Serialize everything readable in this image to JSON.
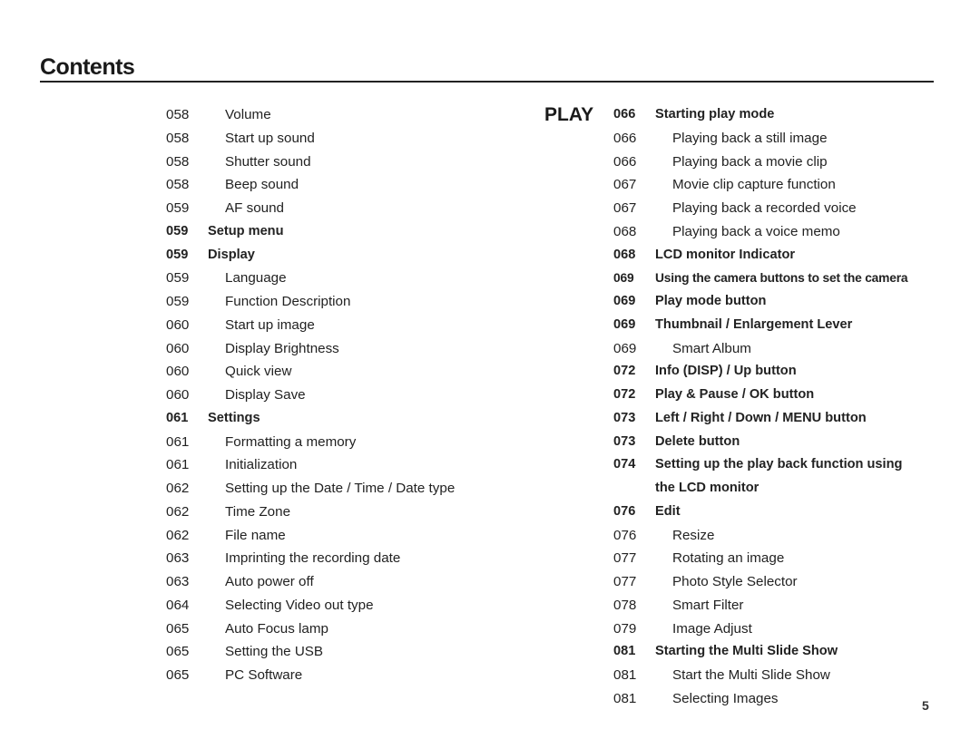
{
  "header": {
    "title": "Contents"
  },
  "section_label": "PLAY",
  "page_number": "5",
  "left_column": [
    {
      "page": "058",
      "label": "Volume",
      "style": "plain"
    },
    {
      "page": "058",
      "label": "Start up sound",
      "style": "plain"
    },
    {
      "page": "058",
      "label": "Shutter sound",
      "style": "plain"
    },
    {
      "page": "058",
      "label": "Beep sound",
      "style": "plain"
    },
    {
      "page": "059",
      "label": "AF sound",
      "style": "plain"
    },
    {
      "page": "059",
      "label": "Setup menu",
      "style": "bold"
    },
    {
      "page": "059",
      "label": "Display",
      "style": "bold"
    },
    {
      "page": "059",
      "label": "Language",
      "style": "plain"
    },
    {
      "page": "059",
      "label": "Function Description",
      "style": "plain"
    },
    {
      "page": "060",
      "label": "Start up image",
      "style": "plain"
    },
    {
      "page": "060",
      "label": "Display Brightness",
      "style": "plain"
    },
    {
      "page": "060",
      "label": "Quick view",
      "style": "plain"
    },
    {
      "page": "060",
      "label": "Display Save",
      "style": "plain"
    },
    {
      "page": "061",
      "label": "Settings",
      "style": "bold"
    },
    {
      "page": "061",
      "label": "Formatting a memory",
      "style": "plain"
    },
    {
      "page": "061",
      "label": "Initialization",
      "style": "plain"
    },
    {
      "page": "062",
      "label": "Setting up the Date / Time / Date type",
      "style": "plain"
    },
    {
      "page": "062",
      "label": "Time Zone",
      "style": "plain"
    },
    {
      "page": "062",
      "label": "File name",
      "style": "plain"
    },
    {
      "page": "063",
      "label": "Imprinting the recording date",
      "style": "plain"
    },
    {
      "page": "063",
      "label": "Auto power off",
      "style": "plain"
    },
    {
      "page": "064",
      "label": "Selecting Video out type",
      "style": "plain"
    },
    {
      "page": "065",
      "label": "Auto Focus lamp",
      "style": "plain"
    },
    {
      "page": "065",
      "label": "Setting the USB",
      "style": "plain"
    },
    {
      "page": "065",
      "label": "PC Software",
      "style": "plain"
    }
  ],
  "right_column": [
    {
      "page": "066",
      "label": "Starting play mode",
      "style": "bold"
    },
    {
      "page": "066",
      "label": "Playing back a still image",
      "style": "sub"
    },
    {
      "page": "066",
      "label": "Playing back a movie clip",
      "style": "sub"
    },
    {
      "page": "067",
      "label": "Movie clip capture function",
      "style": "sub"
    },
    {
      "page": "067",
      "label": "Playing back a recorded voice",
      "style": "sub"
    },
    {
      "page": "068",
      "label": "Playing back a voice memo",
      "style": "sub"
    },
    {
      "page": "068",
      "label": "LCD monitor Indicator",
      "style": "bold"
    },
    {
      "page": "069",
      "label": "Using the camera buttons to set the camera",
      "style": "bold tight"
    },
    {
      "page": "069",
      "label": "Play mode button",
      "style": "bold"
    },
    {
      "page": "069",
      "label": "Thumbnail / Enlargement Lever",
      "style": "bold"
    },
    {
      "page": "069",
      "label": "Smart Album",
      "style": "sub"
    },
    {
      "page": "072",
      "label": "Info (DISP) / Up button",
      "style": "bold"
    },
    {
      "page": "072",
      "label": "Play & Pause / OK button",
      "style": "bold"
    },
    {
      "page": "073",
      "label": "Left / Right / Down / MENU button",
      "style": "bold"
    },
    {
      "page": "073",
      "label": "Delete button",
      "style": "bold"
    },
    {
      "page": "074",
      "label": "Setting up the play back function using",
      "style": "bold"
    },
    {
      "page": "",
      "label": "the LCD monitor",
      "style": "bold cont"
    },
    {
      "page": "076",
      "label": "Edit",
      "style": "bold"
    },
    {
      "page": "076",
      "label": "Resize",
      "style": "sub"
    },
    {
      "page": "077",
      "label": "Rotating an image",
      "style": "sub"
    },
    {
      "page": "077",
      "label": "Photo Style Selector",
      "style": "sub"
    },
    {
      "page": "078",
      "label": "Smart Filter",
      "style": "sub"
    },
    {
      "page": "079",
      "label": "Image Adjust",
      "style": "sub"
    },
    {
      "page": "081",
      "label": "Starting the Multi Slide Show",
      "style": "bold"
    },
    {
      "page": "081",
      "label": "Start the Multi Slide Show",
      "style": "sub"
    },
    {
      "page": "081",
      "label": "Selecting Images",
      "style": "sub"
    }
  ]
}
